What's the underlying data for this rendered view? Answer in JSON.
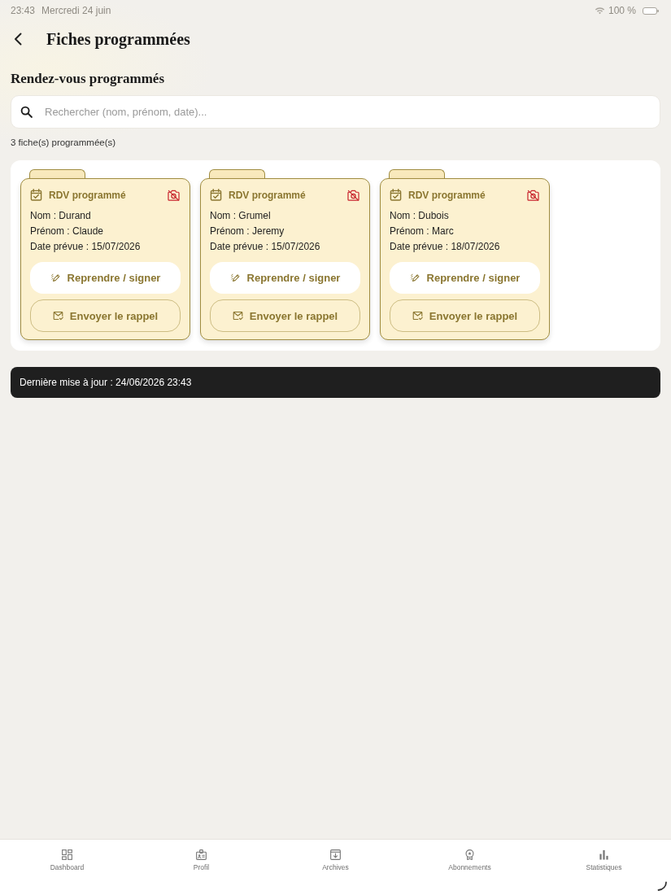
{
  "status_bar": {
    "time": "23:43",
    "date": "Mercredi 24 juin",
    "battery": "100 %"
  },
  "header": {
    "title": "Fiches programmées"
  },
  "section_title": "Rendez-vous programmés",
  "search": {
    "placeholder": "Rechercher (nom, prénom, date)..."
  },
  "count": "3 fiche(s) programmée(s)",
  "cards": [
    {
      "status": "RDV programmé",
      "name": "Nom : Durand",
      "first_name": "Prénom : Claude",
      "date": "Date prévue : 15/07/2026",
      "resume_button": "Reprendre / signer",
      "reminder_button": "Envoyer le rappel"
    },
    {
      "status": "RDV programmé",
      "name": "Nom : Grumel",
      "first_name": "Prénom : Jeremy",
      "date": "Date prévue : 15/07/2026",
      "resume_button": "Reprendre / signer",
      "reminder_button": "Envoyer le rappel"
    },
    {
      "status": "RDV programmé",
      "name": "Nom : Dubois",
      "first_name": "Prénom : Marc",
      "date": "Date prévue : 18/07/2026",
      "resume_button": "Reprendre / signer",
      "reminder_button": "Envoyer le rappel"
    }
  ],
  "last_update": "Dernière mise à jour : 24/06/2026 23:43",
  "nav": [
    {
      "label": "Dashboard"
    },
    {
      "label": "Profil"
    },
    {
      "label": "Archives"
    },
    {
      "label": "Abonnements"
    },
    {
      "label": "Statistiques"
    }
  ]
}
